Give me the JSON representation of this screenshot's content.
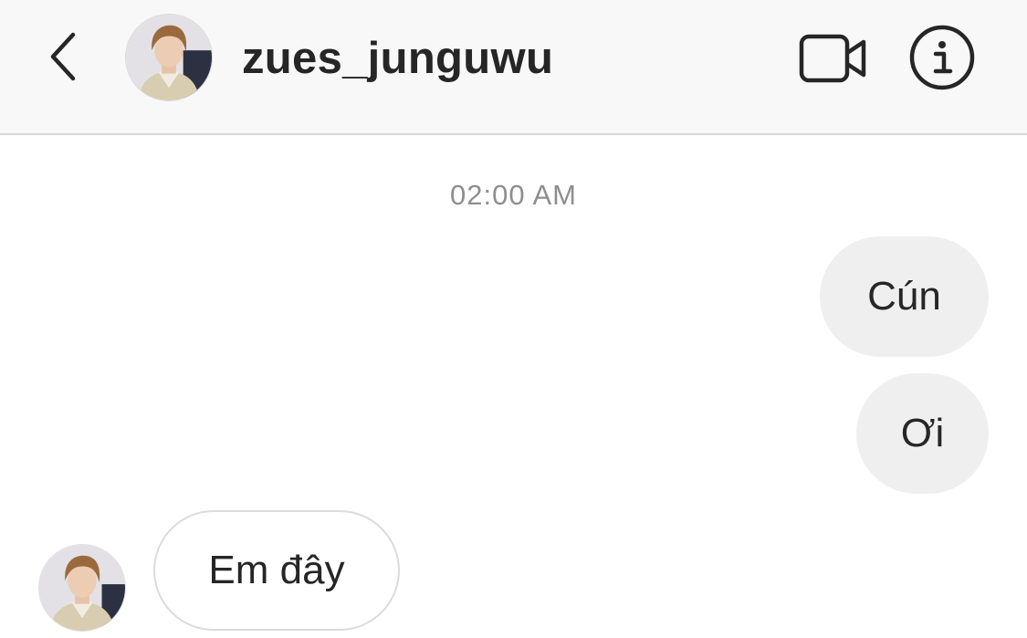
{
  "header": {
    "username": "zues_junguwu",
    "back_icon": "chevron-left-icon",
    "video_icon": "video-camera-icon",
    "info_icon": "info-circle-icon"
  },
  "conversation": {
    "timestamp": "02:00 AM",
    "messages": [
      {
        "direction": "sent",
        "text": "Cún"
      },
      {
        "direction": "sent",
        "text": "Ơi"
      },
      {
        "direction": "received",
        "text": "Em đây"
      }
    ]
  },
  "colors": {
    "header_bg": "#f8f8f8",
    "text_primary": "#262626",
    "timestamp": "#8e8e8e",
    "sent_bubble": "#efefef",
    "received_border": "#dbdbdb"
  }
}
